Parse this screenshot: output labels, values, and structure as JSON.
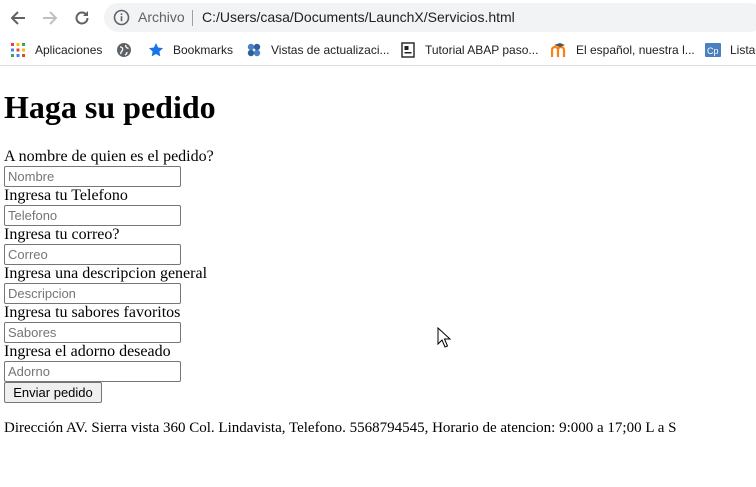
{
  "browser": {
    "scheme_label": "Archivo",
    "url": "C:/Users/casa/Documents/LaunchX/Servicios.html",
    "bookmarks": [
      {
        "label": "Aplicaciones",
        "icon": "apps-grid-icon"
      },
      {
        "label": "",
        "icon": "globe-icon"
      },
      {
        "label": "Bookmarks",
        "icon": "star-icon"
      },
      {
        "label": "Vistas de actualizaci...",
        "icon": "puzzle-icon"
      },
      {
        "label": "Tutorial ABAP paso...",
        "icon": "book-icon"
      },
      {
        "label": "El español, nuestra l...",
        "icon": "moodle-icon"
      },
      {
        "label": "Listad",
        "icon": "cp-icon"
      }
    ]
  },
  "page": {
    "title": "Haga su pedido",
    "fields": [
      {
        "label": "A nombre de quien es el pedido?",
        "placeholder": "Nombre"
      },
      {
        "label": "Ingresa tu Telefono",
        "placeholder": "Telefono"
      },
      {
        "label": "Ingresa tu correo?",
        "placeholder": "Correo"
      },
      {
        "label": "Ingresa una descripcion general",
        "placeholder": "Descripcion"
      },
      {
        "label": "Ingresa tu sabores favoritos",
        "placeholder": "Sabores"
      },
      {
        "label": "Ingresa el adorno deseado",
        "placeholder": "Adorno"
      }
    ],
    "submit_label": "Enviar pedido",
    "footer": "Dirección AV. Sierra vista 360 Col. Lindavista, Telefono. 5568794545, Horario de atencion: 9:000 a 17;00 L a S"
  },
  "colors": {
    "accent_blue": "#1a73e8",
    "omnibox_bg": "#f1f3f4",
    "bookmark_star": "#1a73e8"
  }
}
